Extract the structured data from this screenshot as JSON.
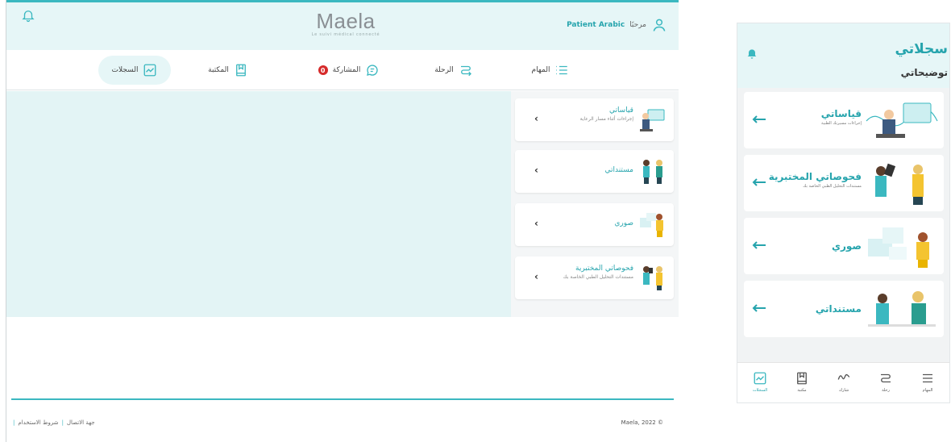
{
  "desktop": {
    "brand": {
      "name": "Maela",
      "tagline": "Le suivi médical connecté"
    },
    "greeting": {
      "prefix": "مرحبًا",
      "user": "Patient Arabic"
    },
    "nav": [
      {
        "label": "المهام",
        "icon": "list-icon"
      },
      {
        "label": "الرحلة",
        "icon": "journey-icon"
      },
      {
        "label": "المشاركة",
        "icon": "chat-icon",
        "badge": "0"
      },
      {
        "label": "المكتبة",
        "icon": "library-icon"
      },
      {
        "label": "السجلات",
        "icon": "records-icon",
        "active": true
      }
    ],
    "cards": [
      {
        "title": "قياساتي",
        "subtitle": "إجراءات أثناء مسار الرعاية"
      },
      {
        "title": "مستنداتي",
        "subtitle": ""
      },
      {
        "title": "صوري",
        "subtitle": ""
      },
      {
        "title": "فحوصاتي المختبرية",
        "subtitle": "مستندات التحليل الطبي الخاصة بك"
      }
    ],
    "footer": {
      "contact": "جهة الاتصال",
      "terms": "شروط الاستخدام",
      "copyright": "Maela, 2022 ©"
    }
  },
  "mobile": {
    "title": "سجلاتي",
    "subtitle": "توضيحاتي",
    "cards": [
      {
        "title": "قياساتي",
        "subtitle": "إجراءات مسيرتك الطبية"
      },
      {
        "title": "فحوصاتي المختبرية",
        "subtitle": "مستندات التحليل الطبي الخاصة بك"
      },
      {
        "title": "صوري",
        "subtitle": ""
      },
      {
        "title": "مستنداتي",
        "subtitle": ""
      }
    ],
    "tabs": [
      {
        "label": "السجلات",
        "active": true
      },
      {
        "label": "مكتبة"
      },
      {
        "label": "شارك"
      },
      {
        "label": "رحلة"
      },
      {
        "label": "المهام"
      }
    ]
  },
  "colors": {
    "accent": "#3bb8c0",
    "accent_text": "#26a4ad",
    "panel": "#e3f4f5",
    "badge": "#d62b2b"
  }
}
